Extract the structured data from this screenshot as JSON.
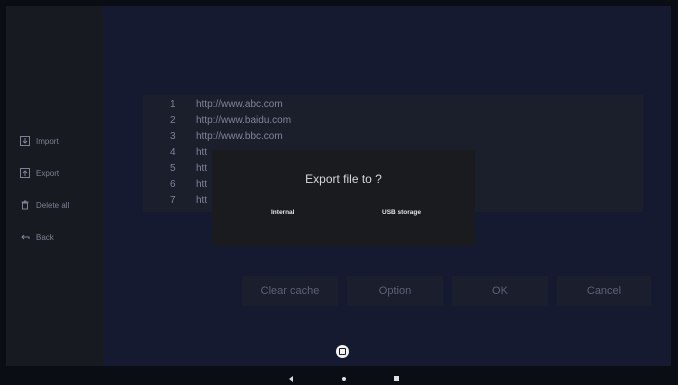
{
  "sidebar": {
    "items": [
      {
        "label": "Import",
        "icon": "import-icon"
      },
      {
        "label": "Export",
        "icon": "export-icon"
      },
      {
        "label": "Delete all",
        "icon": "trash-icon"
      },
      {
        "label": "Back",
        "icon": "back-arrow-icon"
      }
    ]
  },
  "url_list": {
    "rows": [
      {
        "num": "1",
        "url": "http://www.abc.com"
      },
      {
        "num": "2",
        "url": "http://www.baidu.com"
      },
      {
        "num": "3",
        "url": "http://www.bbc.com"
      },
      {
        "num": "4",
        "url": "htt"
      },
      {
        "num": "5",
        "url": "htt"
      },
      {
        "num": "6",
        "url": "htt"
      },
      {
        "num": "7",
        "url": "htt"
      }
    ]
  },
  "buttons": {
    "clear_cache": "Clear cache",
    "option": "Option",
    "ok": "OK",
    "cancel": "Cancel"
  },
  "dialog": {
    "title": "Export file to ?",
    "internal": "Internal",
    "usb": "USB storage"
  },
  "colors": {
    "background": "#0b0d14",
    "sidebar": "#171a20",
    "main": "#161a31",
    "dialog": "#1a1b1f"
  }
}
